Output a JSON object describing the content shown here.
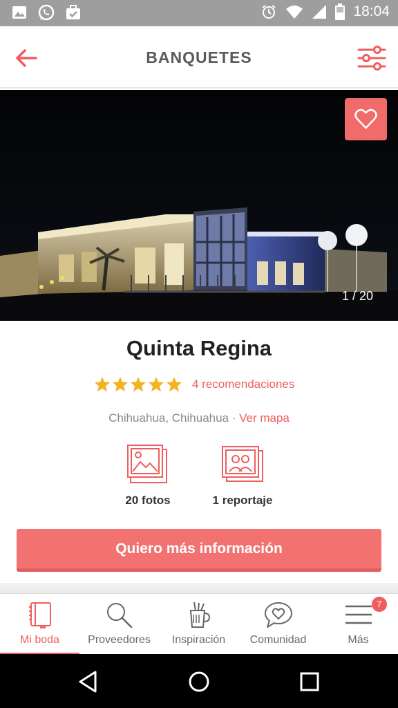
{
  "status_bar": {
    "time": "18:04",
    "icons": [
      "gallery-icon",
      "whatsapp-icon",
      "briefcase-check-icon",
      "alarm-icon",
      "wifi-icon",
      "signal-icon",
      "battery-icon"
    ]
  },
  "app_bar": {
    "title": "BANQUETES",
    "back_icon": "arrow-left-icon",
    "filter_icon": "sliders-icon"
  },
  "hero": {
    "photo_counter": "1 / 20",
    "favorite_icon": "heart-outline-icon"
  },
  "venue": {
    "name": "Quinta Regina",
    "rating_stars": 5,
    "rating_max": 5,
    "recommendations_text": "4 recomendaciones",
    "location_text": "Chihuahua, Chihuahua · ",
    "map_link": "Ver mapa"
  },
  "media": [
    {
      "icon": "photos-icon",
      "label": "20 fotos"
    },
    {
      "icon": "report-album-icon",
      "label": "1 reportaje"
    }
  ],
  "cta": {
    "label": "Quiero más información"
  },
  "tabs": [
    {
      "icon": "notebook-icon",
      "label": "Mi boda",
      "active": true
    },
    {
      "icon": "search-icon",
      "label": "Proveedores",
      "active": false
    },
    {
      "icon": "inspiration-cup-icon",
      "label": "Inspiración",
      "active": false
    },
    {
      "icon": "chat-heart-icon",
      "label": "Comunidad",
      "active": false
    },
    {
      "icon": "menu-icon",
      "label": "Más",
      "active": false,
      "badge": "7"
    }
  ],
  "nav_bar": {
    "icons": [
      "back-triangle-icon",
      "home-circle-icon",
      "recents-square-icon"
    ]
  },
  "colors": {
    "accent": "#ef5d5d",
    "status_bar": "#9e9e9e",
    "star": "#f5b323"
  }
}
